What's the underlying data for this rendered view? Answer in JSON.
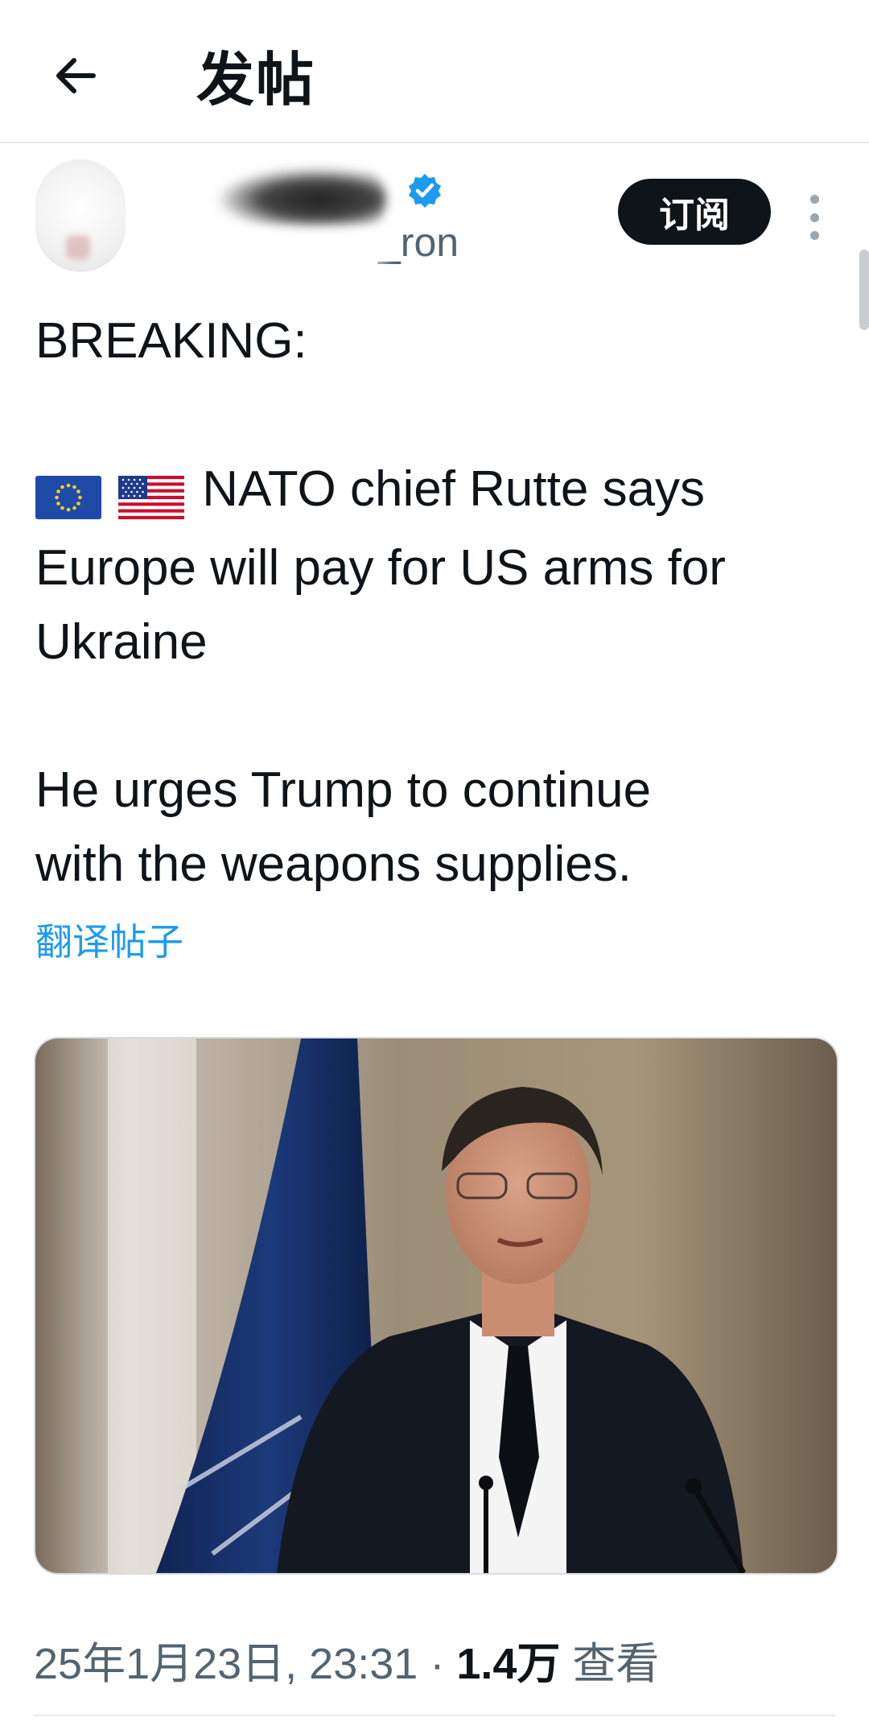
{
  "header": {
    "title": "发帖",
    "back_icon": "arrow-left-icon"
  },
  "author": {
    "handle_suffix": "_ron",
    "verified_icon": "verified-badge-icon",
    "verified_color": "#1d9bf0",
    "subscribe_label": "订阅",
    "more_icon": "more-vertical-icon"
  },
  "post": {
    "line1": "BREAKING:",
    "line2": "NATO chief Rutte says",
    "line3": "Europe will pay for US arms for",
    "line4": "Ukraine",
    "line5": "He urges Trump to continue",
    "line6": "with the weapons supplies.",
    "flags": [
      "eu-flag-icon",
      "us-flag-icon"
    ],
    "translate_label": "翻译帖子",
    "translate_color": "#1d9bf0"
  },
  "meta": {
    "date_time": "25年1月23日, 23:31",
    "separator": "·",
    "views_count": "1.4万",
    "views_label": "查看"
  }
}
